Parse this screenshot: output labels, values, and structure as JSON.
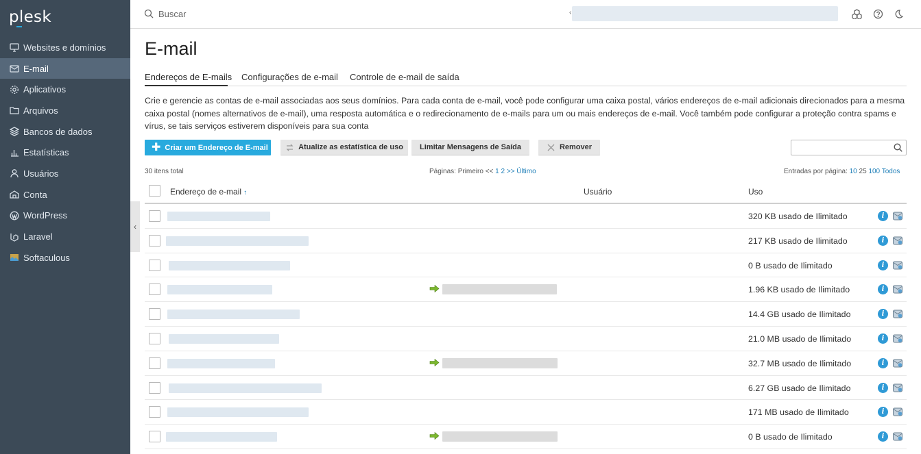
{
  "brand": {
    "logo": "plesk",
    "accent": "#28aade"
  },
  "sidebar": {
    "items": [
      {
        "label": "Websites e domínios",
        "icon": "monitor-icon",
        "active": false
      },
      {
        "label": "E-mail",
        "icon": "mail-icon",
        "active": true
      },
      {
        "label": "Aplicativos",
        "icon": "gear-icon",
        "active": false
      },
      {
        "label": "Arquivos",
        "icon": "folder-icon",
        "active": false
      },
      {
        "label": "Bancos de dados",
        "icon": "database-icon",
        "active": false
      },
      {
        "label": "Estatísticas",
        "icon": "bar-chart-icon",
        "active": false
      },
      {
        "label": "Usuários",
        "icon": "user-icon",
        "active": false
      },
      {
        "label": "Conta",
        "icon": "account-icon",
        "active": false
      },
      {
        "label": "WordPress",
        "icon": "wordpress-icon",
        "active": false
      },
      {
        "label": "Laravel",
        "icon": "laravel-icon",
        "active": false
      },
      {
        "label": "Softaculous",
        "icon": "softaculous-icon",
        "active": false
      }
    ]
  },
  "topbar": {
    "search_placeholder": "Buscar",
    "icons": [
      "search-icon",
      "extensions-icon",
      "help-icon",
      "dark-mode-icon"
    ]
  },
  "page": {
    "title": "E-mail",
    "tabs": [
      {
        "label": "Endereços de E-mails",
        "active": true
      },
      {
        "label": "Configurações de e-mail",
        "active": false
      },
      {
        "label": "Controle de e-mail de saída",
        "active": false
      }
    ],
    "description": "Crie e gerencie as contas de e-mail associadas aos seus domínios. Para cada conta de e-mail, você pode configurar uma caixa postal, vários endereços de e-mail adicionais direcionados para a mesma caixa postal (nomes alternativos de e-mail), uma resposta automática e o redirecionamento de e-mails para um ou mais endereços de e-mail. Você também pode configurar a proteção contra spams e vírus, se tais serviços estiverem disponíveis para sua conta"
  },
  "toolbar": {
    "create_label": "Criar um Endereço de E-mail",
    "update_stats_label": "Atualize as estatística de uso",
    "limit_label": "Limitar Mensagens de Saída",
    "remove_label": "Remover"
  },
  "pager": {
    "total": "30 itens total",
    "pages_prefix": "Páginas: Primeiro <<",
    "page1": "1",
    "page2": "2",
    "next": ">>",
    "last": "Último",
    "entries_label": "Entradas por página:",
    "opt10": "10",
    "opt25": "25",
    "opt100": "100",
    "optall": "Todos"
  },
  "table": {
    "col_email": "Endereço de e-mail",
    "sort_indicator": "↑",
    "col_user": "Usuário",
    "col_usage": "Uso",
    "rows": [
      {
        "usage": "320 KB usado de Ilimitado",
        "forward": false
      },
      {
        "usage": "217 KB usado de Ilimitado",
        "forward": false
      },
      {
        "usage": "0 B usado de Ilimitado",
        "forward": false
      },
      {
        "usage": "1.96 KB usado de Ilimitado",
        "forward": true
      },
      {
        "usage": "14.4 GB usado de Ilimitado",
        "forward": false
      },
      {
        "usage": "21.0 MB usado de Ilimitado",
        "forward": false
      },
      {
        "usage": "32.7 MB usado de Ilimitado",
        "forward": true
      },
      {
        "usage": "6.27 GB usado de Ilimitado",
        "forward": false
      },
      {
        "usage": "171 MB usado de Ilimitado",
        "forward": false
      },
      {
        "usage": "0 B usado de Ilimitado",
        "forward": true
      }
    ]
  }
}
